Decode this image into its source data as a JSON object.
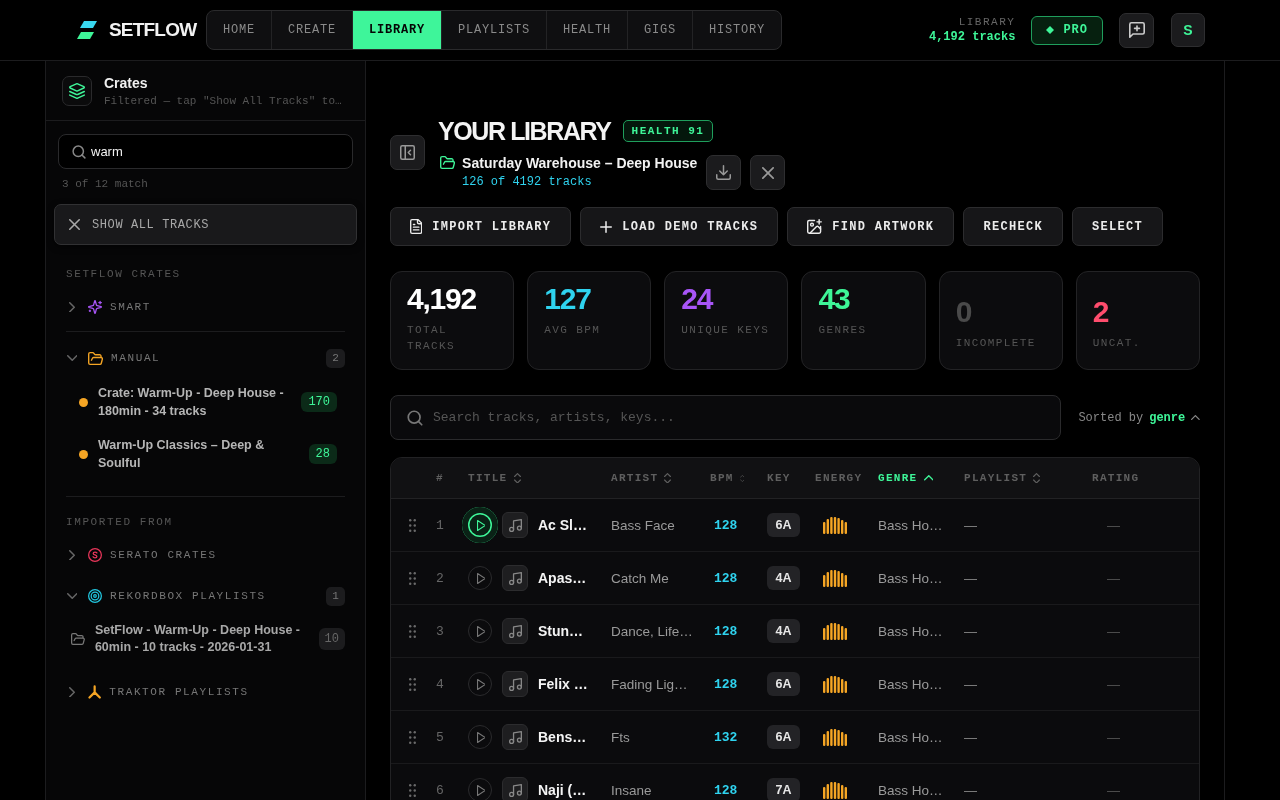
{
  "brand": {
    "name": "SETFLOW"
  },
  "nav": {
    "tabs": [
      {
        "label": "HOME",
        "selected": false
      },
      {
        "label": "CREATE",
        "selected": false
      },
      {
        "label": "LIBRARY",
        "selected": true
      },
      {
        "label": "PLAYLISTS",
        "selected": false
      },
      {
        "label": "HEALTH",
        "selected": false
      },
      {
        "label": "GIGS",
        "selected": false
      },
      {
        "label": "HISTORY",
        "selected": false
      }
    ]
  },
  "library_summary": {
    "label": "LIBRARY",
    "tracks": "4,192 tracks"
  },
  "pro_button": {
    "label": "PRO"
  },
  "avatar": {
    "initial": "S"
  },
  "sidebar": {
    "title": "Crates",
    "subtitle": "Filtered — tap \"Show All Tracks\" to…",
    "search": {
      "value": "warm"
    },
    "match_count": "3 of 12 match",
    "show_all_button": "SHOW ALL TRACKS",
    "sections": [
      {
        "kind": "local",
        "heading": "SETFLOW CRATES",
        "groups": [
          {
            "kind": "smart",
            "label": "SMART",
            "expanded": false
          },
          {
            "kind": "manual",
            "label": "MANUAL",
            "expanded": true,
            "count": "2",
            "children": [
              {
                "kind": "crate",
                "label": "Crate: Warm-Up - Deep House - 180min - 34 tracks",
                "count": "170",
                "color": "#f5a524"
              },
              {
                "kind": "crate",
                "label": "Warm-Up Classics – Deep & Soulful",
                "count": "28",
                "color": "#f5a524"
              }
            ]
          }
        ]
      },
      {
        "kind": "imported",
        "heading": "IMPORTED FROM",
        "groups": [
          {
            "kind": "serato",
            "label": "SERATO CRATES",
            "expanded": false
          },
          {
            "kind": "rekordbox",
            "label": "REKORDBOX PLAYLISTS",
            "expanded": true,
            "count": "1",
            "children": [
              {
                "kind": "playlist",
                "label": "SetFlow - Warm-Up - Deep House - 60min - 10 tracks - 2026-01-31",
                "count": "10"
              }
            ]
          },
          {
            "kind": "traktor",
            "label": "TRAKTOR PLAYLISTS",
            "expanded": false
          }
        ]
      }
    ]
  },
  "library": {
    "title": "YOUR LIBRARY",
    "health_badge": "HEALTH 91",
    "playlist_name": "Saturday Warehouse – Deep House",
    "track_count": "126 of 4192 tracks"
  },
  "actions": [
    {
      "kind": "import",
      "label": "IMPORT LIBRARY"
    },
    {
      "kind": "demo",
      "label": "LOAD DEMO TRACKS"
    },
    {
      "kind": "artwork",
      "label": "FIND ARTWORK"
    },
    {
      "kind": "plain",
      "label": "RECHECK"
    },
    {
      "kind": "plain",
      "label": "SELECT"
    }
  ],
  "stats": [
    {
      "kind": "metric",
      "value": "4,192",
      "label": "TOTAL TRACKS",
      "color": "#ffffff"
    },
    {
      "kind": "metric",
      "value": "127",
      "label": "AVG BPM",
      "color": "#2fd3ef"
    },
    {
      "kind": "metric",
      "value": "24",
      "label": "UNIQUE KEYS",
      "color": "#a855f7"
    },
    {
      "kind": "metric",
      "value": "43",
      "label": "GENRES",
      "color": "#3ef598"
    },
    {
      "kind": "issue",
      "value": "0",
      "label": "INCOMPLETE",
      "color": "#4a4a4a"
    },
    {
      "kind": "issue",
      "value": "2",
      "label": "UNCAT.",
      "color": "#ff4d6d"
    }
  ],
  "search": {
    "placeholder": "Search tracks, artists, keys..."
  },
  "sort": {
    "label": "Sorted by",
    "field": "genre"
  },
  "table": {
    "columns": [
      {
        "label": "#",
        "kind": "plain",
        "selected": false
      },
      {
        "label": "TITLE",
        "kind": "sortable",
        "selected": false
      },
      {
        "label": "ARTIST",
        "kind": "sortable",
        "selected": false
      },
      {
        "label": "BPM",
        "kind": "mini",
        "selected": false
      },
      {
        "label": "KEY",
        "kind": "plain",
        "selected": false
      },
      {
        "label": "ENERGY",
        "kind": "plain",
        "selected": false
      },
      {
        "label": "GENRE",
        "kind": "sortable",
        "selected": true
      },
      {
        "label": "PLAYLIST",
        "kind": "sortable",
        "selected": false
      },
      {
        "label": "RATING",
        "kind": "plain",
        "selected": false
      }
    ],
    "rows": [
      {
        "number": "1",
        "title": "Ac Sl…",
        "artist": "Bass Face",
        "bpm": "128",
        "key": "6A",
        "genre": "Bass Ho…",
        "playlist": "—",
        "rating": "—",
        "playing": true
      },
      {
        "number": "2",
        "title": "Apas…",
        "artist": "Catch Me",
        "bpm": "128",
        "key": "4A",
        "genre": "Bass Ho…",
        "playlist": "—",
        "rating": "—",
        "playing": false
      },
      {
        "number": "3",
        "title": "Stun…",
        "artist": "Dance, Life…",
        "bpm": "128",
        "key": "4A",
        "genre": "Bass Ho…",
        "playlist": "—",
        "rating": "—",
        "playing": false
      },
      {
        "number": "4",
        "title": "Felix …",
        "artist": "Fading Lig…",
        "bpm": "128",
        "key": "6A",
        "genre": "Bass Ho…",
        "playlist": "—",
        "rating": "—",
        "playing": false
      },
      {
        "number": "5",
        "title": "Bens…",
        "artist": "Fts",
        "bpm": "132",
        "key": "6A",
        "genre": "Bass Ho…",
        "playlist": "—",
        "rating": "—",
        "playing": false
      },
      {
        "number": "6",
        "title": "Naji (…",
        "artist": "Insane",
        "bpm": "128",
        "key": "7A",
        "genre": "Bass Ho…",
        "playlist": "—",
        "rating": "—",
        "playing": false
      }
    ]
  }
}
